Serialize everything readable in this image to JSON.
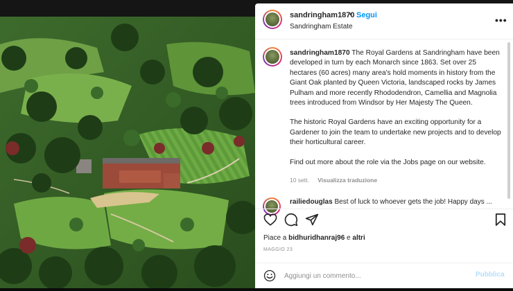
{
  "post": {
    "username": "sandringham1870",
    "separator": "•",
    "follow_label": "Segui",
    "location": "Sandringham Estate",
    "more_label": "•••"
  },
  "caption": {
    "username": "sandringham1870",
    "paragraph1": "The Royal Gardens at Sandringham have been developed in turn by each Monarch since 1863. Set over 25 hectares (60 acres) many area's hold moments in history from the Giant Oak planted by Queen Victoria, landscaped rocks by James Pulham and more recently Rhododendron, Camellia and Magnolia trees introduced from Windsor by Her Majesty The Queen.",
    "paragraph2": "The historic Royal Gardens have an exciting opportunity for a Gardener to join the team to undertake new projects and to develop their horticultural career.",
    "paragraph3": "Find out more about the role via the Jobs page on our website.",
    "age": "10 sett.",
    "translate_label": "Visualizza traduzione"
  },
  "comment": {
    "username": "railiedouglas",
    "text": "Best of luck to whoever gets the job! Happy days ..."
  },
  "actions": {
    "like_icon": "heart-icon",
    "comment_icon": "comment-icon",
    "share_icon": "paper-plane-icon",
    "save_icon": "bookmark-icon"
  },
  "likes": {
    "prefix": "Piace a",
    "user": "bidhuridhanraj96",
    "connector": "e",
    "others": "altri"
  },
  "date": "MAGGIO 23",
  "add_comment": {
    "emoji_icon": "smiley-icon",
    "placeholder": "Aggiungi un commento...",
    "publish_label": "Pubblica"
  },
  "colors": {
    "link_blue": "#0095f6",
    "publish_disabled": "#b2dffc",
    "text": "#262626",
    "muted": "#8e8e8e"
  }
}
